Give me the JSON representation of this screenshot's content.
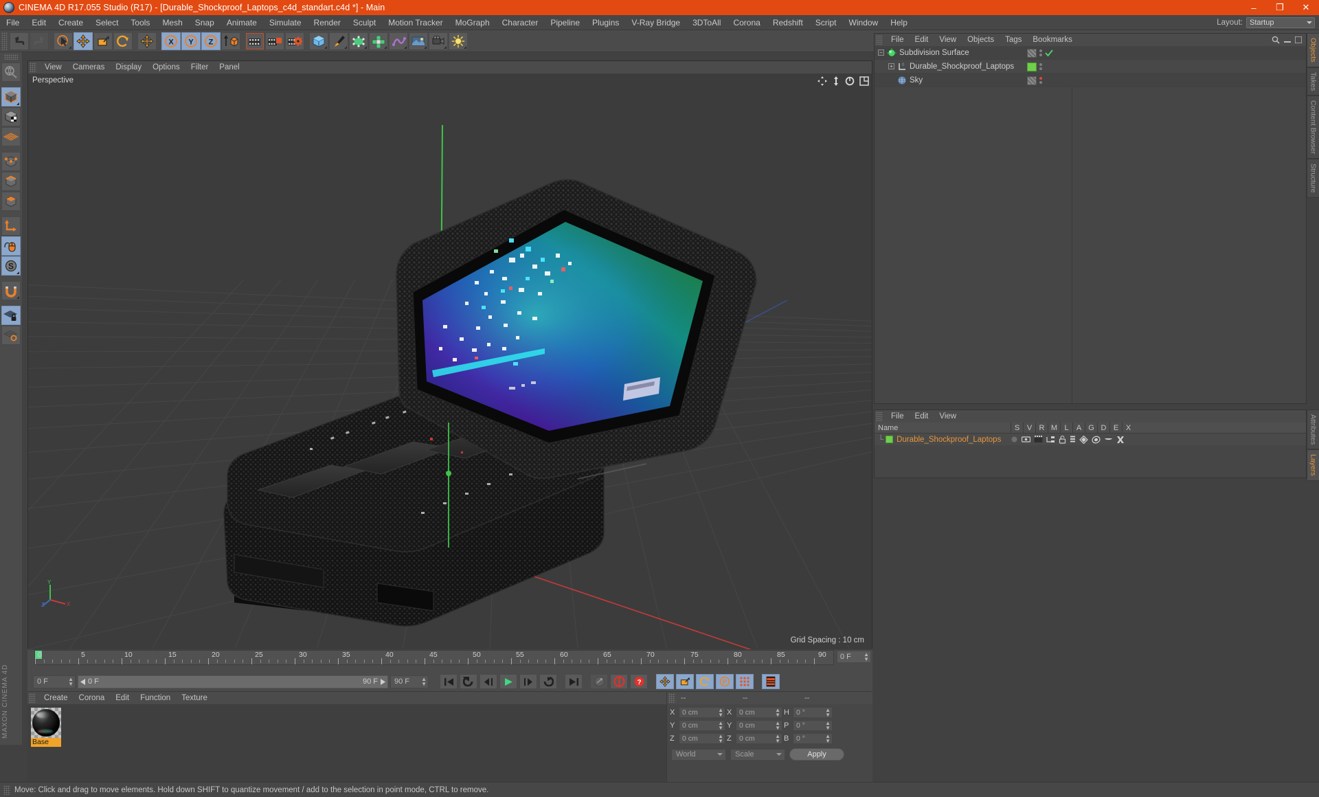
{
  "titlebar": {
    "title": "CINEMA 4D R17.055 Studio (R17) - [Durable_Shockproof_Laptops_c4d_standart.c4d *] - Main",
    "icon": "cinema4d-logo-icon",
    "minimize": "–",
    "maximize": "❐",
    "close": "✕"
  },
  "menubar": {
    "items": [
      "File",
      "Edit",
      "Create",
      "Select",
      "Tools",
      "Mesh",
      "Snap",
      "Animate",
      "Simulate",
      "Render",
      "Sculpt",
      "Motion Tracker",
      "MoGraph",
      "Character",
      "Pipeline",
      "Plugins",
      "V-Ray Bridge",
      "3DToAll",
      "Corona",
      "Redshift",
      "Script",
      "Window",
      "Help"
    ],
    "layout_label": "Layout:",
    "layout_value": "Startup"
  },
  "toolbar": {
    "groups": [
      {
        "buttons": [
          {
            "name": "undo-button",
            "state": "normal"
          },
          {
            "name": "redo-button",
            "state": "disabled"
          }
        ]
      },
      {
        "buttons": [
          {
            "name": "live-selection-tool",
            "state": "normal"
          },
          {
            "name": "move-tool",
            "state": "active"
          },
          {
            "name": "scale-tool",
            "state": "normal"
          },
          {
            "name": "rotate-tool",
            "state": "normal"
          }
        ]
      },
      {
        "buttons": [
          {
            "name": "move-axis-tool",
            "state": "normal"
          }
        ]
      },
      {
        "buttons": [
          {
            "name": "lock-x-axis-button",
            "state": "active",
            "label": "X"
          },
          {
            "name": "lock-y-axis-button",
            "state": "active",
            "label": "Y"
          },
          {
            "name": "lock-z-axis-button",
            "state": "active",
            "label": "Z"
          },
          {
            "name": "world-object-coordinates-button",
            "state": "normal"
          }
        ]
      },
      {
        "buttons": [
          {
            "name": "render-view-button",
            "state": "normal"
          },
          {
            "name": "render-to-picture-viewer-button",
            "state": "normal"
          },
          {
            "name": "render-settings-button",
            "state": "normal"
          }
        ]
      },
      {
        "buttons": [
          {
            "name": "add-cube-object-button",
            "state": "normal"
          },
          {
            "name": "add-spline-pen-button",
            "state": "normal"
          },
          {
            "name": "add-generator-button",
            "state": "normal"
          },
          {
            "name": "add-array-object-button",
            "state": "normal"
          },
          {
            "name": "add-deformer-button",
            "state": "normal"
          },
          {
            "name": "add-scene-environment-button",
            "state": "normal"
          },
          {
            "name": "add-camera-button",
            "state": "normal"
          },
          {
            "name": "add-light-button",
            "state": "normal"
          }
        ]
      }
    ]
  },
  "left_toolbar": {
    "buttons": [
      {
        "name": "make-editable-button",
        "state": "normal"
      },
      {
        "name": "model-mode-button",
        "state": "active"
      },
      {
        "name": "texture-mode-button",
        "state": "normal"
      },
      {
        "name": "use-polygon-tool-button",
        "state": "normal"
      },
      {
        "name": "points-mode-button",
        "state": "normal"
      },
      {
        "name": "edges-mode-button",
        "state": "normal"
      },
      {
        "name": "polygons-mode-button",
        "state": "normal"
      },
      {
        "name": "object-axis-mode-button",
        "state": "normal"
      },
      {
        "name": "enable-axis-modification-button",
        "state": "active"
      },
      {
        "name": "enable-snap-button",
        "state": "active"
      },
      {
        "name": "magnet-tool-button",
        "state": "normal"
      },
      {
        "name": "lock-workplane-button",
        "state": "active"
      },
      {
        "name": "workplane-button",
        "state": "normal"
      }
    ]
  },
  "viewport": {
    "menu": [
      "View",
      "Cameras",
      "Display",
      "Options",
      "Filter",
      "Panel"
    ],
    "label": "Perspective",
    "grid_spacing": "Grid Spacing : 10 cm",
    "nav_icons": [
      "move-view-icon",
      "scale-view-icon",
      "rotate-view-icon",
      "panel-layout-icon"
    ]
  },
  "timeline": {
    "ticks": [
      "0",
      "5",
      "10",
      "15",
      "20",
      "25",
      "30",
      "35",
      "40",
      "45",
      "50",
      "55",
      "60",
      "65",
      "70",
      "75",
      "80",
      "85",
      "90"
    ],
    "current_frame_field": "0 F",
    "min_frame": "0 F",
    "max_frame": "90 F",
    "end_frame": "90 F",
    "preview_min": "0 F",
    "preview_max": "90 F"
  },
  "playback": {
    "buttons": [
      {
        "name": "go-to-start-button"
      },
      {
        "name": "go-to-previous-key-button"
      },
      {
        "name": "step-back-button"
      },
      {
        "name": "play-button"
      },
      {
        "name": "step-forward-button"
      },
      {
        "name": "go-to-next-key-button"
      },
      {
        "name": "go-to-end-button"
      },
      {
        "name": "record-active-objects-button"
      },
      {
        "name": "autokeying-button"
      },
      {
        "name": "keyframe-selection-button"
      },
      {
        "name": "position-key-button",
        "state": "active"
      },
      {
        "name": "scale-key-button",
        "state": "active"
      },
      {
        "name": "rotation-key-button",
        "state": "active"
      },
      {
        "name": "parameter-key-button",
        "state": "active"
      },
      {
        "name": "point-level-animation-button",
        "state": "active"
      },
      {
        "name": "timeline-button",
        "state": "active"
      }
    ]
  },
  "material_manager": {
    "menu": [
      "Create",
      "Corona",
      "Edit",
      "Function",
      "Texture"
    ],
    "materials": [
      {
        "name": "Base",
        "selected": true
      }
    ]
  },
  "coordinate_manager": {
    "headers": [
      "--",
      "--",
      "--"
    ],
    "rows": [
      {
        "pos_label": "X",
        "pos_value": "0 cm",
        "size_label": "X",
        "size_value": "0 cm",
        "rot_label": "H",
        "rot_value": "0 °"
      },
      {
        "pos_label": "Y",
        "pos_value": "0 cm",
        "size_label": "Y",
        "size_value": "0 cm",
        "rot_label": "P",
        "rot_value": "0 °"
      },
      {
        "pos_label": "Z",
        "pos_value": "0 cm",
        "size_label": "Z",
        "size_value": "0 cm",
        "rot_label": "B",
        "rot_value": "0 °"
      }
    ],
    "coord_system": "World",
    "mode": "Scale",
    "apply_label": "Apply"
  },
  "object_manager": {
    "menu": [
      "File",
      "Edit",
      "View",
      "Objects",
      "Tags",
      "Bookmarks"
    ],
    "rows": [
      {
        "name": "Subdivision Surface",
        "icon": "subdivision-surface-icon",
        "indent": 0,
        "expander": "−",
        "tag": "checker",
        "dot": "normal",
        "check": true
      },
      {
        "name": "Durable_Shockproof_Laptops",
        "icon": "null-object-icon",
        "indent": 1,
        "expander": "+",
        "tag": "green",
        "dot": "normal",
        "check": false
      },
      {
        "name": "Sky",
        "icon": "sky-object-icon",
        "indent": 1,
        "expander": "",
        "tag": "checker",
        "dot": "red",
        "check": false
      }
    ]
  },
  "layer_manager": {
    "menu": [
      "File",
      "Edit",
      "View"
    ],
    "columns": [
      "Name",
      "S",
      "V",
      "R",
      "M",
      "L",
      "A",
      "G",
      "D",
      "E",
      "X"
    ],
    "rows": [
      {
        "name": "Durable_Shockproof_Laptops",
        "color": "#6fd04a"
      }
    ]
  },
  "right_tabs": {
    "top": [
      {
        "label": "Objects",
        "active": true
      },
      {
        "label": "Takes",
        "active": false
      },
      {
        "label": "Content Browser",
        "active": false
      },
      {
        "label": "Structure",
        "active": false
      }
    ],
    "bottom": [
      {
        "label": "Attributes",
        "active": false
      },
      {
        "label": "Layers",
        "active": true
      }
    ]
  },
  "statusbar": {
    "text": "Move: Click and drag to move elements. Hold down SHIFT to quantize movement / add to the selection in point mode, CTRL to remove."
  },
  "colors": {
    "accent_orange": "#e24a12",
    "panel_bg": "#474747",
    "viewport_bg": "#3c3c3c",
    "active_blue": "#8ba7cc",
    "green": "#6fd04a",
    "highlight_orange": "#f0a32a"
  },
  "brand": "MAXON CINEMA 4D"
}
